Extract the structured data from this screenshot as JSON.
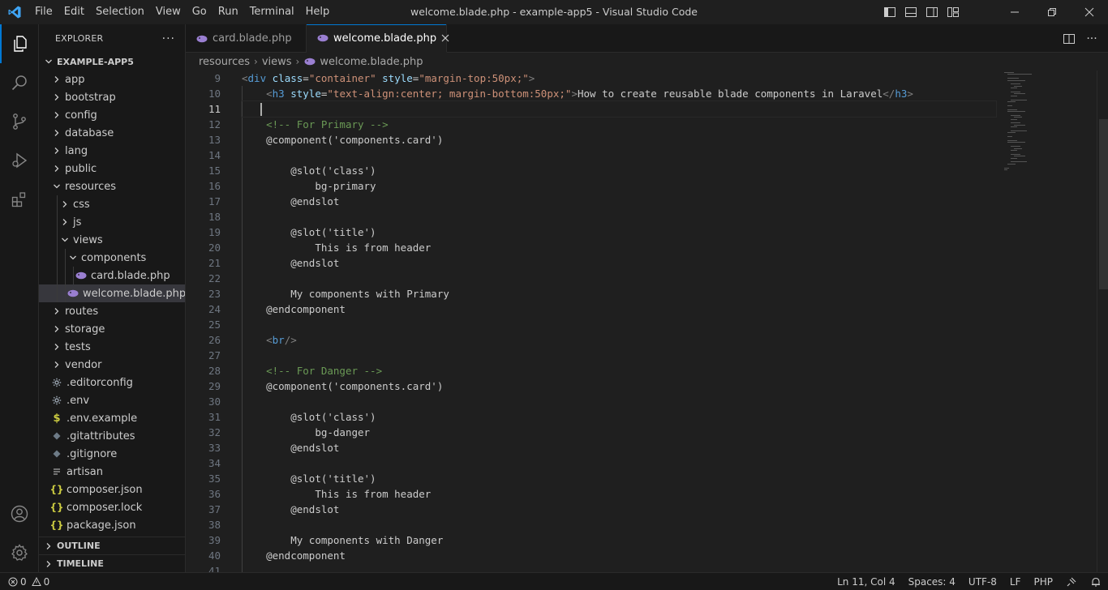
{
  "titlebar": {
    "menu": [
      "File",
      "Edit",
      "Selection",
      "View",
      "Go",
      "Run",
      "Terminal",
      "Help"
    ],
    "title": "welcome.blade.php - example-app5 - Visual Studio Code"
  },
  "sidebar": {
    "header": "EXPLORER",
    "root": "EXAMPLE-APP5",
    "outline": "OUTLINE",
    "timeline": "TIMELINE",
    "items": [
      {
        "label": "app"
      },
      {
        "label": "bootstrap"
      },
      {
        "label": "config"
      },
      {
        "label": "database"
      },
      {
        "label": "lang"
      },
      {
        "label": "public"
      },
      {
        "label": "resources"
      },
      {
        "label": "css"
      },
      {
        "label": "js"
      },
      {
        "label": "views"
      },
      {
        "label": "components"
      },
      {
        "label": "card.blade.php"
      },
      {
        "label": "welcome.blade.php"
      },
      {
        "label": "routes"
      },
      {
        "label": "storage"
      },
      {
        "label": "tests"
      },
      {
        "label": "vendor"
      },
      {
        "label": ".editorconfig"
      },
      {
        "label": ".env"
      },
      {
        "label": ".env.example"
      },
      {
        "label": ".gitattributes"
      },
      {
        "label": ".gitignore"
      },
      {
        "label": "artisan"
      },
      {
        "label": "composer.json"
      },
      {
        "label": "composer.lock"
      },
      {
        "label": "package.json"
      }
    ]
  },
  "tabs": [
    {
      "label": "card.blade.php"
    },
    {
      "label": "welcome.blade.php"
    }
  ],
  "breadcrumb": [
    "resources",
    "views",
    "welcome.blade.php"
  ],
  "editor": {
    "line_numbers": [
      "9",
      "10",
      "11",
      "12",
      "13",
      "14",
      "15",
      "16",
      "17",
      "18",
      "19",
      "20",
      "21",
      "22",
      "23",
      "24",
      "25",
      "26",
      "27",
      "28",
      "29",
      "30",
      "31",
      "32",
      "33",
      "34",
      "35",
      "36",
      "37",
      "38",
      "39",
      "40",
      "41"
    ],
    "lines": {
      "l9_tag": "div",
      "l9_attr1": "class",
      "l9_val1": "\"container\"",
      "l9_attr2": "style",
      "l9_val2": "\"margin-top:50px;\"",
      "l10_tag": "h3",
      "l10_attr": "style",
      "l10_val": "\"text-align:center; margin-bottom:50px;\"",
      "l10_text": "How to create reusable blade components in Laravel",
      "l10_close": "h3",
      "l12": "<!-- For Primary -->",
      "l13": "@component('components.card')",
      "l15": "@slot('class')",
      "l16": "bg-primary",
      "l17": "@endslot",
      "l19": "@slot('title')",
      "l20": "This is from header",
      "l21": "@endslot",
      "l23": "My components with Primary",
      "l24": "@endcomponent",
      "l26_tag": "br",
      "l28": "<!-- For Danger -->",
      "l29": "@component('components.card')",
      "l31": "@slot('class')",
      "l32": "bg-danger",
      "l33": "@endslot",
      "l35": "@slot('title')",
      "l36": "This is from header",
      "l37": "@endslot",
      "l39": "My components with Danger",
      "l40": "@endcomponent"
    }
  },
  "statusbar": {
    "errors": "0",
    "warnings": "0",
    "position": "Ln 11, Col 4",
    "spaces": "Spaces: 4",
    "encoding": "UTF-8",
    "eol": "LF",
    "language": "PHP"
  }
}
